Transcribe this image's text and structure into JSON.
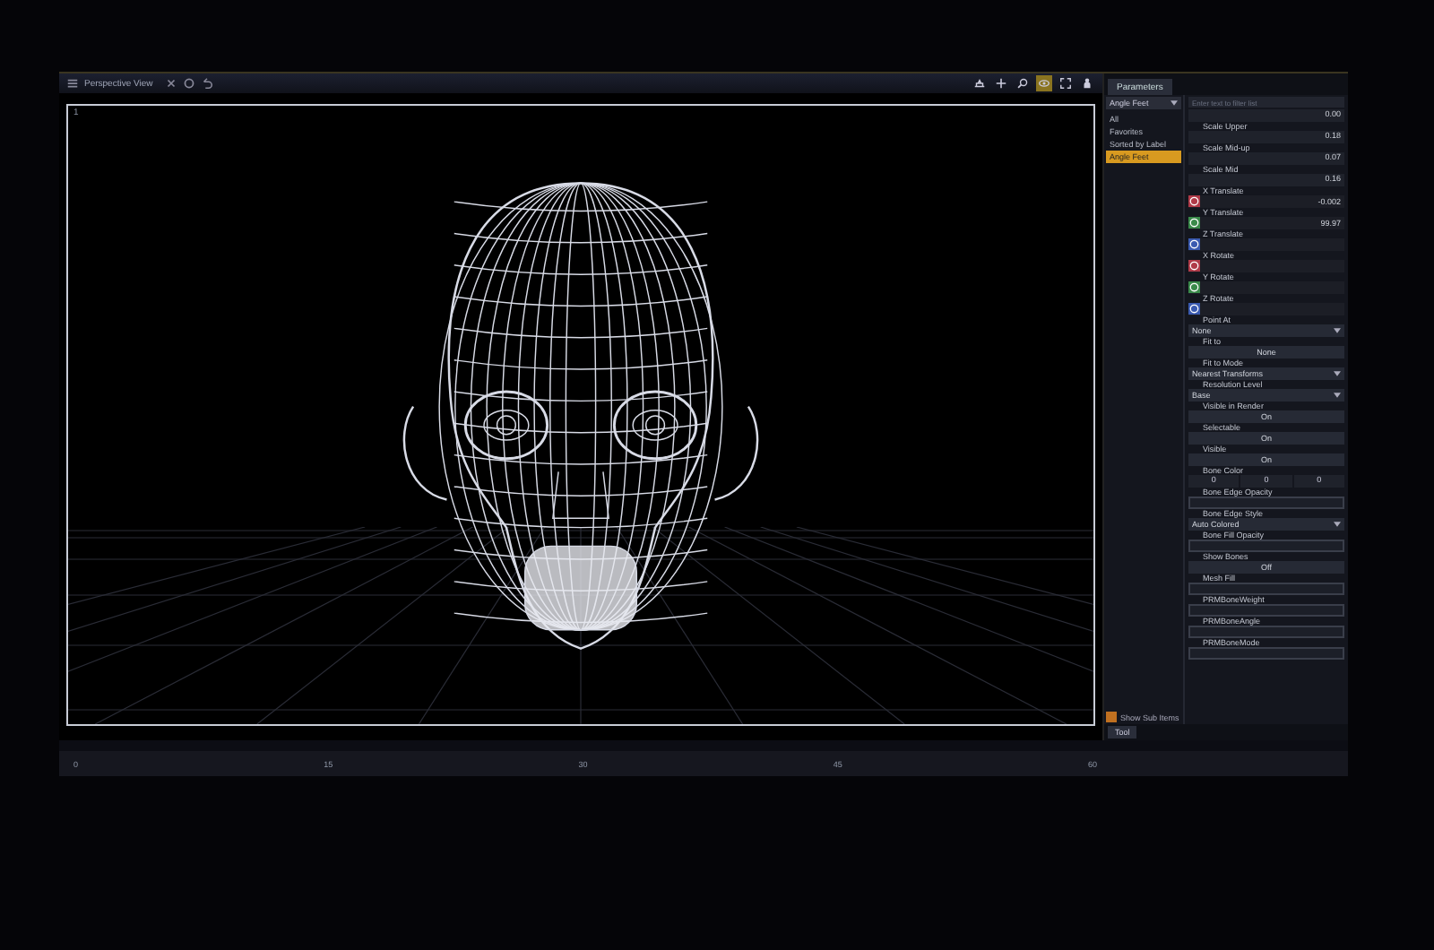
{
  "viewport": {
    "title": "Perspective View",
    "corner_label": "1"
  },
  "toolbar": [
    {
      "selected": false
    },
    {
      "selected": false
    },
    {
      "selected": false
    },
    {
      "selected": true
    },
    {
      "selected": false
    },
    {
      "selected": false
    }
  ],
  "parameters": {
    "tab": "Parameters",
    "dropdown": "Angle Feet",
    "search_placeholder": "Enter text to filter list",
    "groups": [
      {
        "label": "All",
        "selected": false
      },
      {
        "label": "Favorites",
        "selected": false
      },
      {
        "label": "Sorted by Label",
        "selected": false
      },
      {
        "label": "Angle Feet",
        "selected": true
      }
    ],
    "props": [
      {
        "kind": "value",
        "value": "0.00"
      },
      {
        "kind": "value",
        "label": "Scale Upper",
        "value": "0.18"
      },
      {
        "kind": "value",
        "label": "Scale Mid-up",
        "value": "0.07"
      },
      {
        "kind": "value",
        "label": "Scale Mid",
        "value": "0.16"
      },
      {
        "kind": "dial",
        "label": "X Translate",
        "value": "-0.002",
        "color": "#b03a48"
      },
      {
        "kind": "dial",
        "label": "Y Translate",
        "value": "99.97",
        "color": "#3a8a4a"
      },
      {
        "kind": "dial",
        "label": "Z Translate",
        "color": "#3a5ab0"
      },
      {
        "kind": "dial",
        "label": "X Rotate",
        "color": "#b03a48"
      },
      {
        "kind": "dial",
        "label": "Y Rotate",
        "color": "#3a8a4a"
      },
      {
        "kind": "dial",
        "label": "Z Rotate",
        "color": "#3a5ab0"
      },
      {
        "kind": "select",
        "label": "Point At",
        "value": "None"
      },
      {
        "kind": "button",
        "label": "Fit to",
        "value": "None"
      },
      {
        "kind": "select",
        "label": "Fit to Mode",
        "value": "Nearest Transforms"
      },
      {
        "kind": "select",
        "label": "Resolution Level",
        "value": "Base"
      },
      {
        "kind": "button",
        "label": "Visible in Render",
        "value": "On"
      },
      {
        "kind": "button",
        "label": "Selectable",
        "value": "On"
      },
      {
        "kind": "button",
        "label": "Visible",
        "value": "On"
      },
      {
        "kind": "triple",
        "label": "Bone Color",
        "values": [
          "0",
          "0",
          "0"
        ]
      },
      {
        "kind": "field",
        "label": "Bone Edge Opacity"
      },
      {
        "kind": "select",
        "label": "Bone Edge Style",
        "value": "Auto Colored"
      },
      {
        "kind": "field",
        "label": "Bone Fill Opacity"
      },
      {
        "kind": "button",
        "label": "Show Bones",
        "value": "Off"
      },
      {
        "kind": "field",
        "label": "Mesh Fill"
      },
      {
        "kind": "field",
        "label": "PRMBoneWeight"
      },
      {
        "kind": "field",
        "label": "PRMBoneAngle"
      },
      {
        "kind": "field",
        "label": "PRMBoneMode"
      }
    ],
    "show_sub_items": {
      "label": "Show Sub Items",
      "checked": true
    },
    "tool_button": "Tool"
  },
  "timeline": {
    "ticks": [
      "0",
      "15",
      "30",
      "45",
      "60"
    ]
  }
}
